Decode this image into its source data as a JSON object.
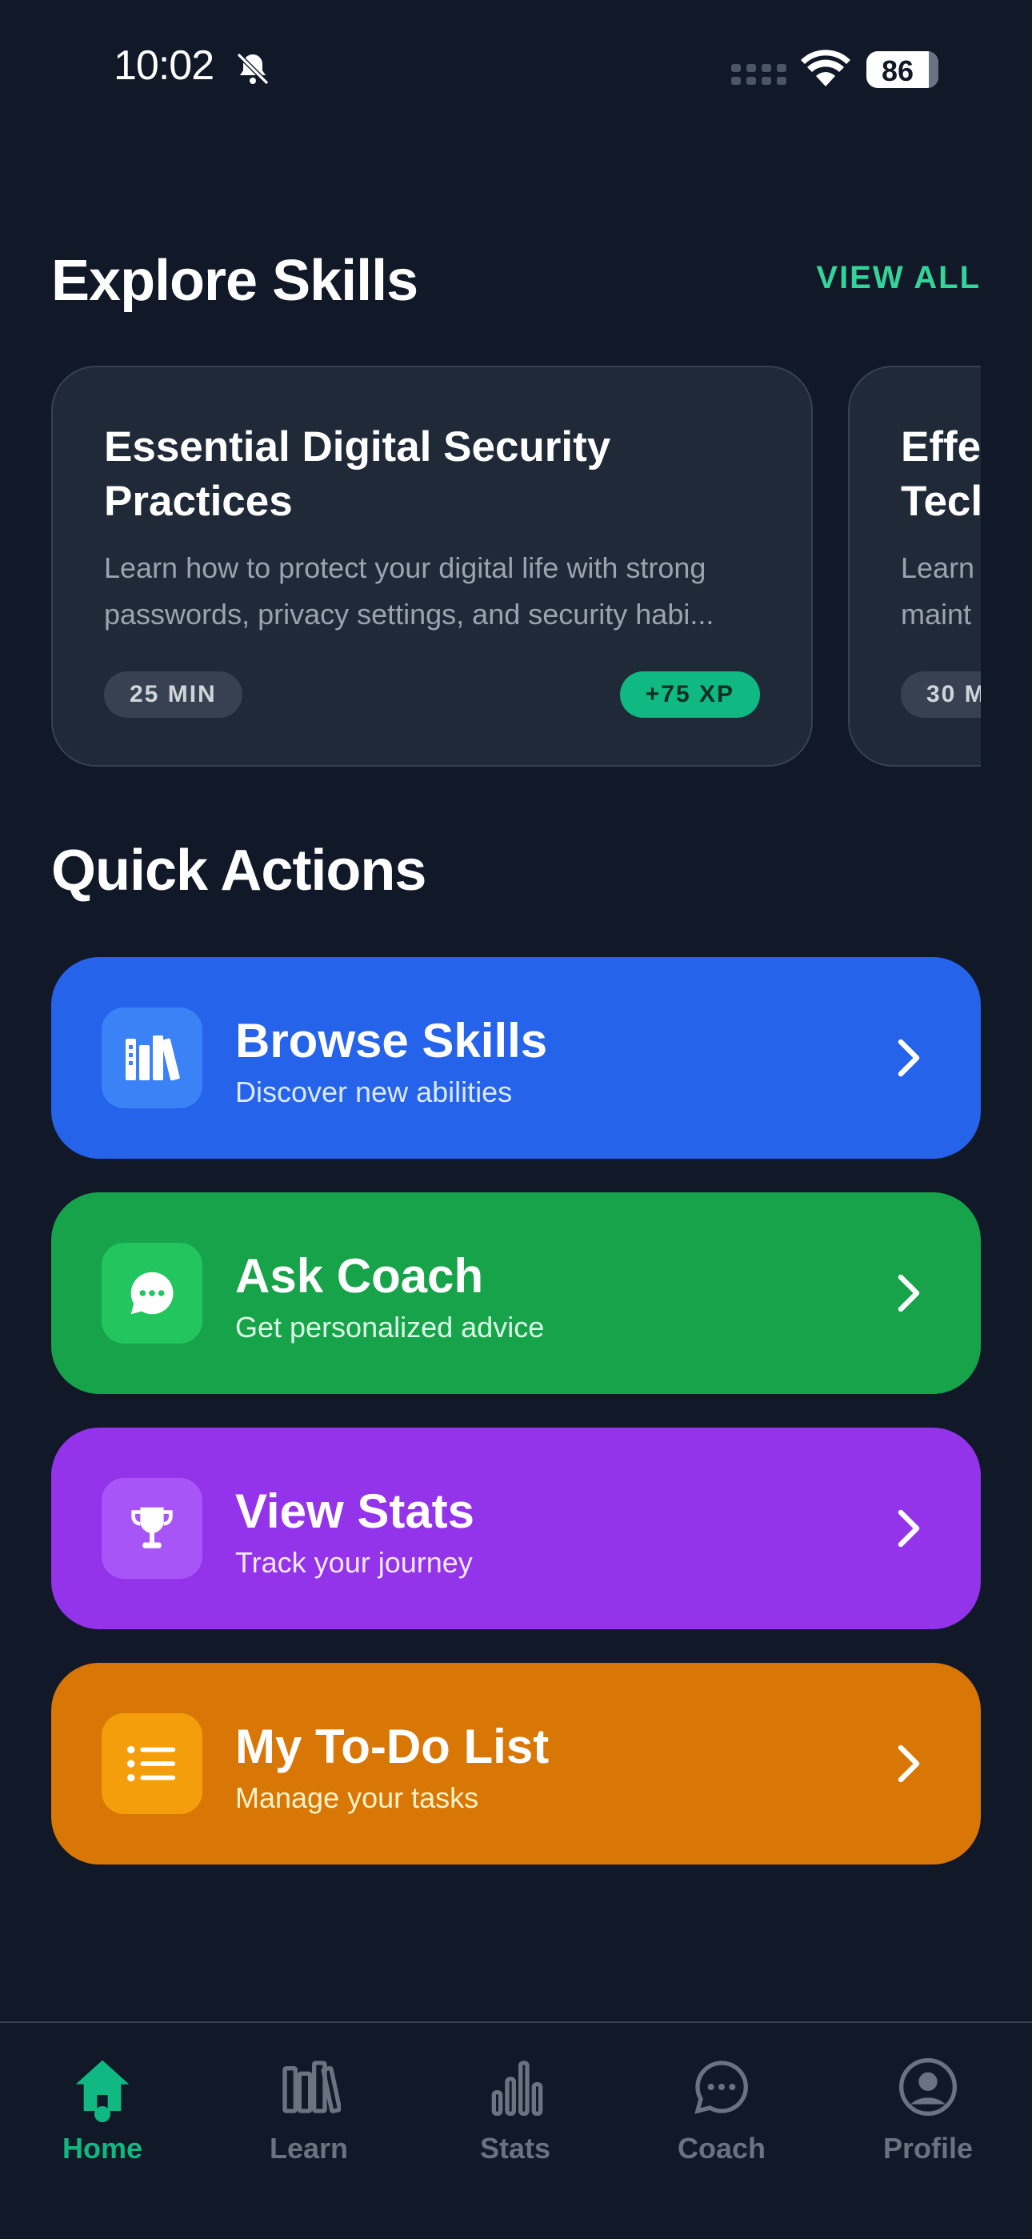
{
  "status_bar": {
    "time": "10:02",
    "battery": "86"
  },
  "explore": {
    "title": "Explore Skills",
    "view_all": "VIEW ALL",
    "cards": [
      {
        "title": "Essential Digital Security Practices",
        "description": "Learn how to protect your digital life with strong passwords, privacy settings, and security habi...",
        "duration": "25 MIN",
        "xp": "+75 XP"
      },
      {
        "title": "Effe Tecl",
        "description": "Learn maint",
        "duration": "30 M"
      }
    ]
  },
  "quick_actions": {
    "title": "Quick Actions",
    "items": [
      {
        "label": "Browse Skills",
        "sub": "Discover new abilities",
        "color": "#2563eb",
        "icon": "books-icon"
      },
      {
        "label": "Ask Coach",
        "sub": "Get personalized advice",
        "color": "#16a34a",
        "icon": "chat-icon"
      },
      {
        "label": "View Stats",
        "sub": "Track your journey",
        "color": "#9333ea",
        "icon": "trophy-icon"
      },
      {
        "label": "My To-Do List",
        "sub": "Manage your tasks",
        "color": "#d97706",
        "icon": "list-icon"
      }
    ]
  },
  "tabs": [
    {
      "label": "Home",
      "active": true,
      "icon": "home-icon"
    },
    {
      "label": "Learn",
      "icon": "books-icon"
    },
    {
      "label": "Stats",
      "icon": "bar-chart-icon"
    },
    {
      "label": "Coach",
      "icon": "chat-icon"
    },
    {
      "label": "Profile",
      "icon": "user-icon"
    }
  ],
  "colors": {
    "accent": "#10b981",
    "background": "#111827",
    "card": "#1f2937"
  }
}
